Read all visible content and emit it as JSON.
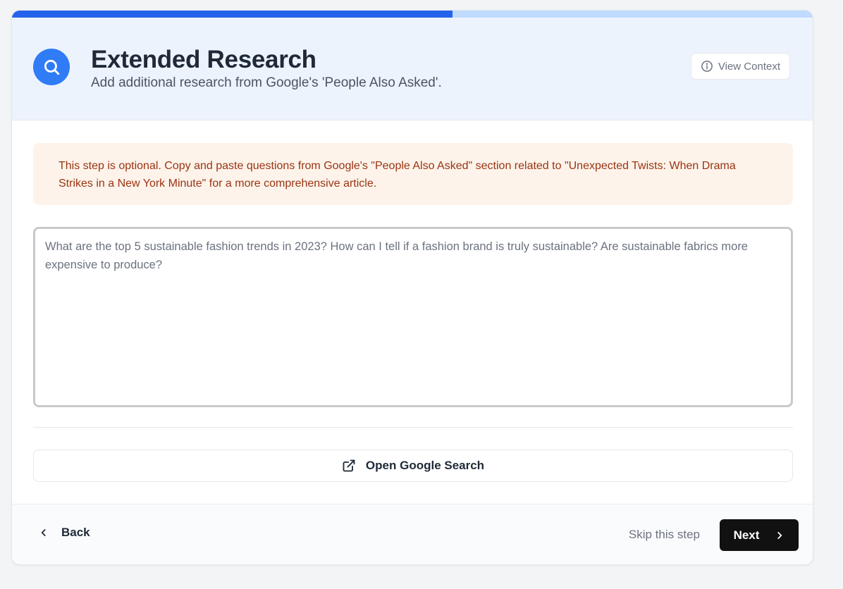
{
  "progress": {
    "percent": 55
  },
  "header": {
    "title": "Extended Research",
    "subtitle": "Add additional research from Google's 'People Also Asked'.",
    "icon": "search-icon",
    "view_context_label": "View Context"
  },
  "notice": {
    "text": "This step is optional. Copy and paste questions from Google's \"People Also Asked\" section related to \"Unexpected Twists: When Drama Strikes in a New York Minute\" for a more comprehensive article."
  },
  "questions": {
    "placeholder": "What are the top 5 sustainable fashion trends in 2023? How can I tell if a fashion brand is truly sustainable? Are sustainable fabrics more expensive to produce?",
    "value": ""
  },
  "google_search": {
    "label": "Open Google Search",
    "icon": "external-link-icon"
  },
  "footer": {
    "back_label": "Back",
    "skip_label": "Skip this step",
    "next_label": "Next"
  },
  "colors": {
    "accent": "#2f7cf6",
    "progress_fill": "#2563eb",
    "progress_track": "#bfdbfe",
    "notice_bg": "#fdf3ea",
    "notice_text": "#9a3412",
    "header_bg": "#edf3fd",
    "primary_button": "#111111"
  }
}
